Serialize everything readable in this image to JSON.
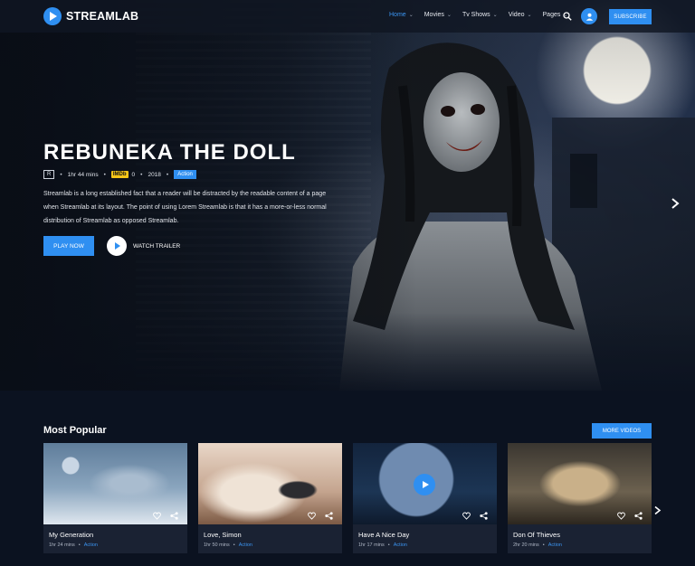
{
  "brand": {
    "name": "STREAMLAB"
  },
  "nav": {
    "items": [
      {
        "label": "Home",
        "active": true
      },
      {
        "label": "Movies",
        "active": false
      },
      {
        "label": "Tv Shows",
        "active": false
      },
      {
        "label": "Video",
        "active": false
      },
      {
        "label": "Pages",
        "active": false
      }
    ],
    "subscribe_label": "SUBSCRIBE"
  },
  "hero": {
    "title": "REBUNEKA THE DOLL",
    "rating": "R",
    "duration": "1hr 44 mins",
    "imdb_label": "IMDb",
    "imdb_score": "0",
    "year": "2018",
    "genre": "Action",
    "description": "Streamlab is a long established fact that a reader will be distracted by the readable content of a page when Streamlab at its layout. The point of using Lorem Streamlab is that it has a more-or-less normal distribution of Streamlab as opposed Streamlab.",
    "play_label": "PLAY NOW",
    "trailer_label": "WATCH TRAILER"
  },
  "popular": {
    "title": "Most Popular",
    "more_label": "MORE VIDEOS",
    "cards": [
      {
        "title": "My Generation",
        "duration": "1hr 24 mins",
        "genre": "Action"
      },
      {
        "title": "Love, Simon",
        "duration": "1hr 50 mins",
        "genre": "Action"
      },
      {
        "title": "Have A Nice Day",
        "duration": "1hr 17 mins",
        "genre": "Action"
      },
      {
        "title": "Don Of Thieves",
        "duration": "2hr 20 mins",
        "genre": "Action"
      }
    ]
  },
  "colors": {
    "accent": "#2f8ff1",
    "background": "#0b1220",
    "card": "#1a2233",
    "imdb": "#f5c518"
  }
}
